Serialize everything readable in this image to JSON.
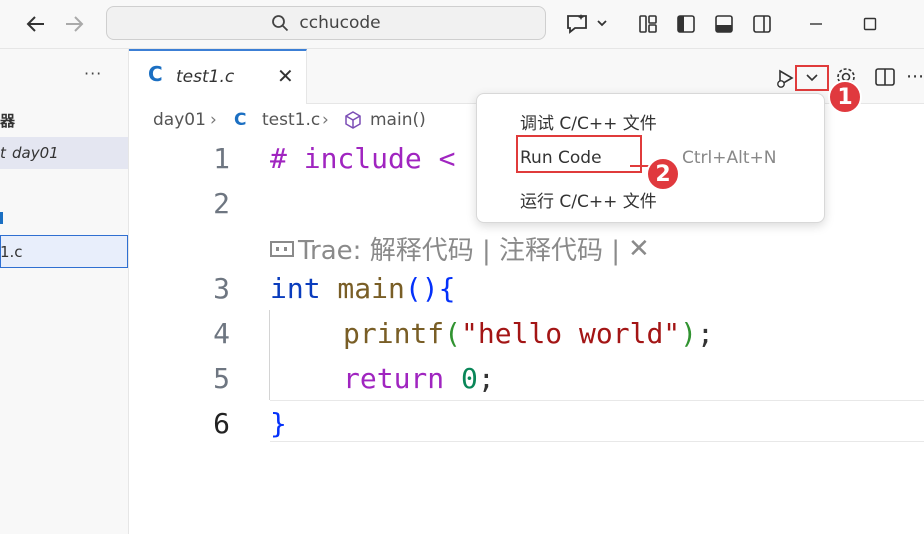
{
  "search": {
    "text": "cchucode"
  },
  "sidebar": {
    "more": "···",
    "fragments": [
      "器",
      "t",
      "day01",
      "1.c"
    ]
  },
  "tab": {
    "lang_icon": "C",
    "name": "test1.c",
    "close": "✕"
  },
  "breadcrumb": {
    "folder": "day01",
    "file": "test1.c",
    "symbol": "main()"
  },
  "editor": {
    "line_numbers": [
      "1",
      "2",
      "3",
      "4",
      "5",
      "6"
    ],
    "line1_pre": "# include",
    "line1_rest": " <",
    "line3_type": "int",
    "line3_fn": " main",
    "line3_parens": "()",
    "line3_brace": "{",
    "line4_fn": "printf",
    "line4_open": "(",
    "line4_str": "\"hello world\"",
    "line4_close": ")",
    "line4_semi": ";",
    "line5_kw": "return",
    "line5_num": "0",
    "line5_semi": ";",
    "line6_brace": "}",
    "codelens": "Trae: 解释代码 | 注释代码 |",
    "codelens_close": "✕"
  },
  "menu": {
    "items": [
      "调试 C/C++ 文件",
      "Run Code",
      "运行 C/C++ 文件"
    ],
    "shortcut": "Ctrl+Alt+N"
  },
  "badges": [
    "1",
    "2"
  ],
  "colors": {
    "accent": "#3c7fd5",
    "highlight": "#e03b3b",
    "keyword": "#a025c0",
    "type": "#0a3cbd"
  }
}
